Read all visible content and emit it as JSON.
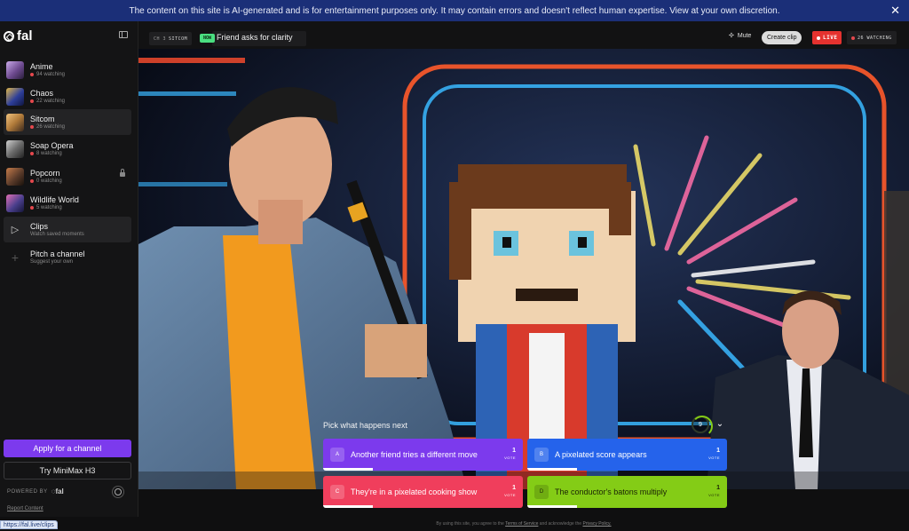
{
  "banner": {
    "text": "The content on this site is AI-generated and is for entertainment purposes only. It may contain errors and doesn't reflect human expertise. View at your own discretion.",
    "close_glyph": "✕"
  },
  "brand": {
    "name": "fal"
  },
  "sidebar": {
    "channels": [
      {
        "name": "Anime",
        "watching": "94 watching",
        "thumb": "#6d4a8f"
      },
      {
        "name": "Chaos",
        "watching": "22 watching",
        "thumb": "#2e3f9a"
      },
      {
        "name": "Sitcom",
        "watching": "26 watching",
        "thumb": "#b07a3a"
      },
      {
        "name": "Soap Opera",
        "watching": "8 watching",
        "thumb": "#6c6c6c"
      },
      {
        "name": "Popcorn",
        "watching": "0 watching",
        "thumb": "#5a3b2a"
      },
      {
        "name": "Wildlife World",
        "watching": "5 watching",
        "thumb": "#4a3f8c"
      }
    ],
    "clips": {
      "label": "Clips",
      "sub": "Watch saved moments",
      "glyph": "▷"
    },
    "pitch": {
      "label": "Pitch a channel",
      "sub": "Suggest your own",
      "glyph": "+"
    },
    "apply_label": "Apply for a channel",
    "try_label": "Try MiniMax H3",
    "powered_label": "POWERED BY",
    "powered_brand": "◌fal",
    "report_label": "Report Content"
  },
  "topbar": {
    "ch_prefix": "CH 3",
    "ch_name": "SITCOM",
    "now_label": "NOW",
    "now_title": "Friend asks for clarity",
    "mute_label": "Mute",
    "mute_glyph": "✣",
    "clip_label": "Create clip",
    "live_label": "LIVE",
    "watching_label": "26 WATCHING"
  },
  "poll": {
    "prompt": "Pick what happens next",
    "timer": "9",
    "chevron": "⌄",
    "options": [
      {
        "letter": "A",
        "text": "Another friend tries a different move",
        "votes": "1",
        "vote_label": "VOTE",
        "share": 0.25
      },
      {
        "letter": "B",
        "text": "A pixelated score appears",
        "votes": "1",
        "vote_label": "VOTE",
        "share": 0.25
      },
      {
        "letter": "C",
        "text": "They're in a pixelated cooking show",
        "votes": "1",
        "vote_label": "VOTE",
        "share": 0.25
      },
      {
        "letter": "D",
        "text": "The conductor's batons multiply",
        "votes": "1",
        "vote_label": "VOTE",
        "share": 0.25
      }
    ]
  },
  "footer": {
    "text_a": "By using this site, you agree to the",
    "tos": "Terms of Service",
    "text_b": "and acknowledge the",
    "privacy": "Privacy Policy."
  },
  "status_url": "https://fal.live/clips",
  "colors": {
    "accent": "#7c3aed",
    "live": "#e5322f",
    "now": "#4ade80",
    "option_b": "#2563eb",
    "option_c": "#f03e5c",
    "option_d": "#84cc16"
  }
}
